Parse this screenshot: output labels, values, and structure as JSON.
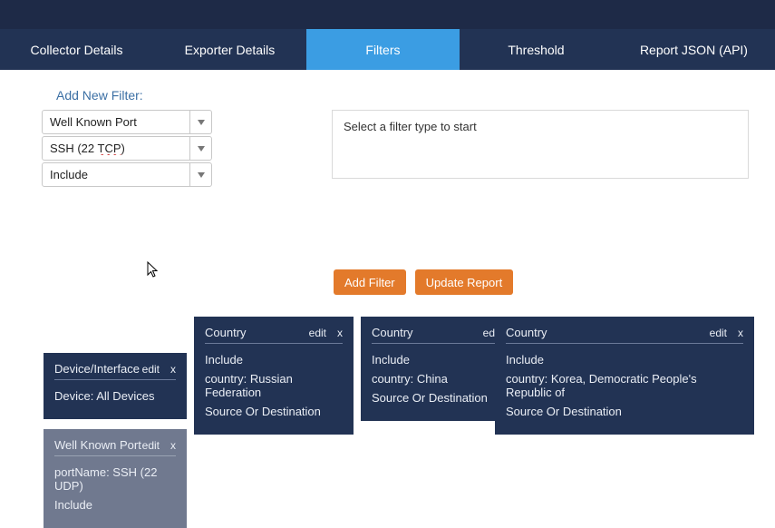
{
  "tabs": {
    "items": [
      {
        "label": "Collector Details"
      },
      {
        "label": "Exporter Details"
      },
      {
        "label": "Filters"
      },
      {
        "label": "Threshold"
      },
      {
        "label": "Report JSON (API)"
      }
    ],
    "activeIndex": 2
  },
  "addNew": {
    "heading": "Add New Filter:",
    "filterType": "Well Known Port",
    "filterValue_pre": "SSH (22 ",
    "filterValue_deco": "TCP",
    "filterValue_post": ")",
    "mode": "Include"
  },
  "hint": "Select a filter type to start",
  "buttons": {
    "add": "Add Filter",
    "update": "Update Report"
  },
  "cards": {
    "ui": {
      "edit": "edit",
      "close": "x"
    },
    "device": {
      "title": "Device/Interface",
      "line1": "Device: All Devices"
    },
    "country1": {
      "title": "Country",
      "l1": "Include",
      "l2": "country: Russian Federation",
      "l3": "Source Or Destination"
    },
    "country2": {
      "title": "Country",
      "l1": "Include",
      "l2": "country: China",
      "l3": "Source Or Destination"
    },
    "country3": {
      "title": "Country",
      "l1": "Include",
      "l2": "country: Korea, Democratic People's Republic of",
      "l3": "Source Or Destination"
    },
    "port": {
      "title": "Well Known Port",
      "l1": "portName: SSH (22 UDP)",
      "l2": "Include"
    }
  }
}
